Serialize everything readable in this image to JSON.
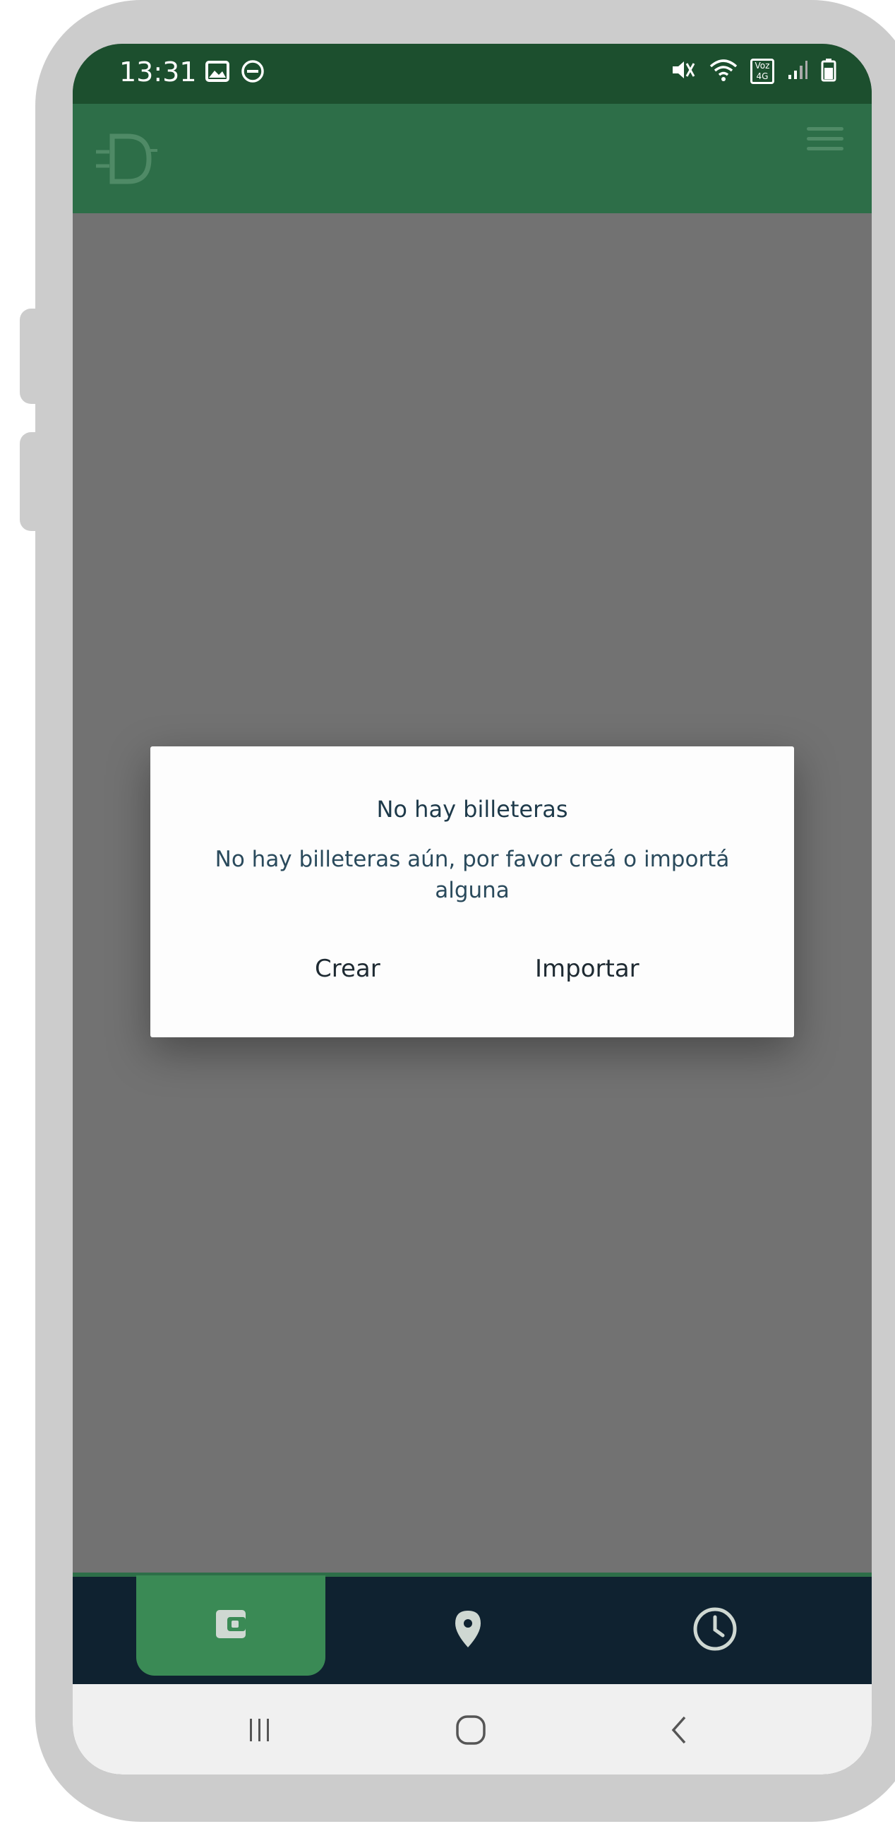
{
  "status_bar": {
    "time": "13:31",
    "left_icons": [
      "image-icon",
      "minus-circle-icon"
    ],
    "right_icons": [
      "mute-icon",
      "wifi-icon",
      "volte-4g-icon",
      "signal-icon",
      "battery-icon"
    ],
    "volte_label": "Voz",
    "network_label": "4G"
  },
  "app_bar": {
    "logo_icon": "app-logo-icon",
    "menu_icon": "hamburger-menu-icon",
    "color": "#2d6e48"
  },
  "dialog": {
    "title": "No hay billeteras",
    "message": "No hay billeteras aún, por favor creá o importá alguna",
    "create_label": "Crear",
    "import_label": "Importar"
  },
  "bottom_nav": {
    "items": [
      {
        "icon": "wallet-icon",
        "active": true
      },
      {
        "icon": "location-pin-icon",
        "active": false
      },
      {
        "icon": "clock-icon",
        "active": false
      }
    ],
    "active_color": "#3a8a55",
    "background": "#0f2230"
  },
  "system_nav": {
    "icons": [
      "recents-icon",
      "home-icon",
      "back-icon"
    ]
  },
  "colors": {
    "status_bar": "#1c4f2e",
    "overlay": "#727272",
    "dialog_text": "#1e3a4a"
  }
}
